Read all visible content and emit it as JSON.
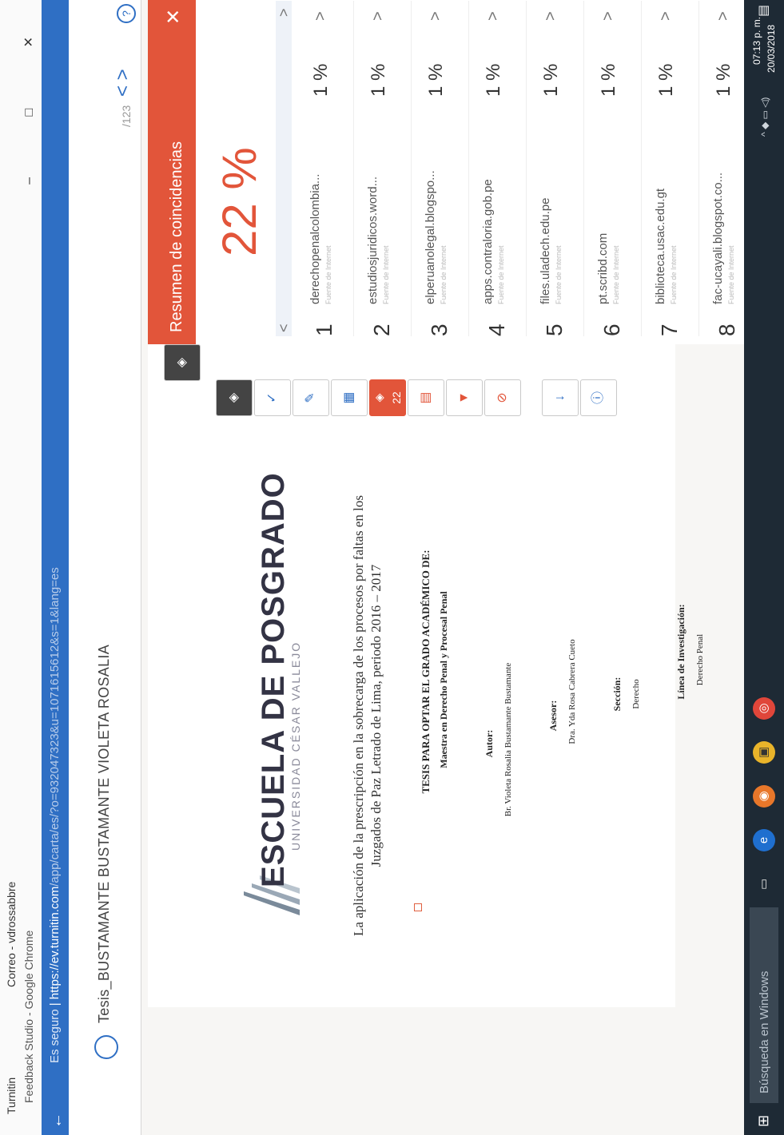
{
  "window": {
    "tab1": "Turnitin",
    "tab2": "Correo - vdrossabbre",
    "title": "Feedback Studio - Google Chrome",
    "controls": "–  □  ✕"
  },
  "address": {
    "secure": "Es seguro",
    "url": "https://ev.turnitin.com",
    "url_rest": "/app/carta/es/?o=932047323&u=1071615612&s=1&lang=es"
  },
  "doc": {
    "title": "Tesis_BUSTAMANTE BUSTAMANTE VIOLETA ROSALIA",
    "pager": "/123"
  },
  "page": {
    "school": "ESCUELA DE POSGRADO",
    "university": "UNIVERSIDAD CÉSAR VALLEJO",
    "thesis_title": "La aplicación de la prescripción en la sobrecarga de los procesos por faltas en los Juzgados de Paz Letrado de Lima, periodo 2016 – 2017",
    "degree_label": "TESIS PARA OPTAR EL GRADO ACADÉMICO DE:",
    "degree": "Maestra en Derecho Penal y Procesal Penal",
    "author_label": "Autor:",
    "author": "Br. Violeta Rosalia Bustamante Bustamante",
    "advisor_label": "Asesor:",
    "advisor": "Dra. Yda Rosa Cabrera Cueto",
    "section_label": "Sección:",
    "section": "Derecho",
    "line_label": "Línea de Investigación:",
    "line": "Derecho Penal"
  },
  "toolbar": {
    "match_count": "22"
  },
  "sidebar": {
    "title": "Resumen de coincidencias",
    "overall": "22 %",
    "source_type": "Fuente de Internet",
    "matches": [
      {
        "num": "1",
        "source": "derechopenalcolombia...",
        "pct": "1 %"
      },
      {
        "num": "2",
        "source": "estudiosjuridicos.word...",
        "pct": "1 %"
      },
      {
        "num": "3",
        "source": "elperuanolegal.blogspo...",
        "pct": "1 %"
      },
      {
        "num": "4",
        "source": "apps.contraloria.gob.pe",
        "pct": "1 %"
      },
      {
        "num": "5",
        "source": "files.uladech.edu.pe",
        "pct": "1 %"
      },
      {
        "num": "6",
        "source": "pt.scribd.com",
        "pct": "1 %"
      },
      {
        "num": "7",
        "source": "biblioteca.usac.edu.gt",
        "pct": "1 %"
      },
      {
        "num": "8",
        "source": "fac-ucayali.blogspot.co...",
        "pct": "1 %"
      }
    ]
  },
  "taskbar": {
    "search": "Búsqueda en Windows",
    "time": "07:13 p. m.",
    "date": "20/03/2018"
  }
}
